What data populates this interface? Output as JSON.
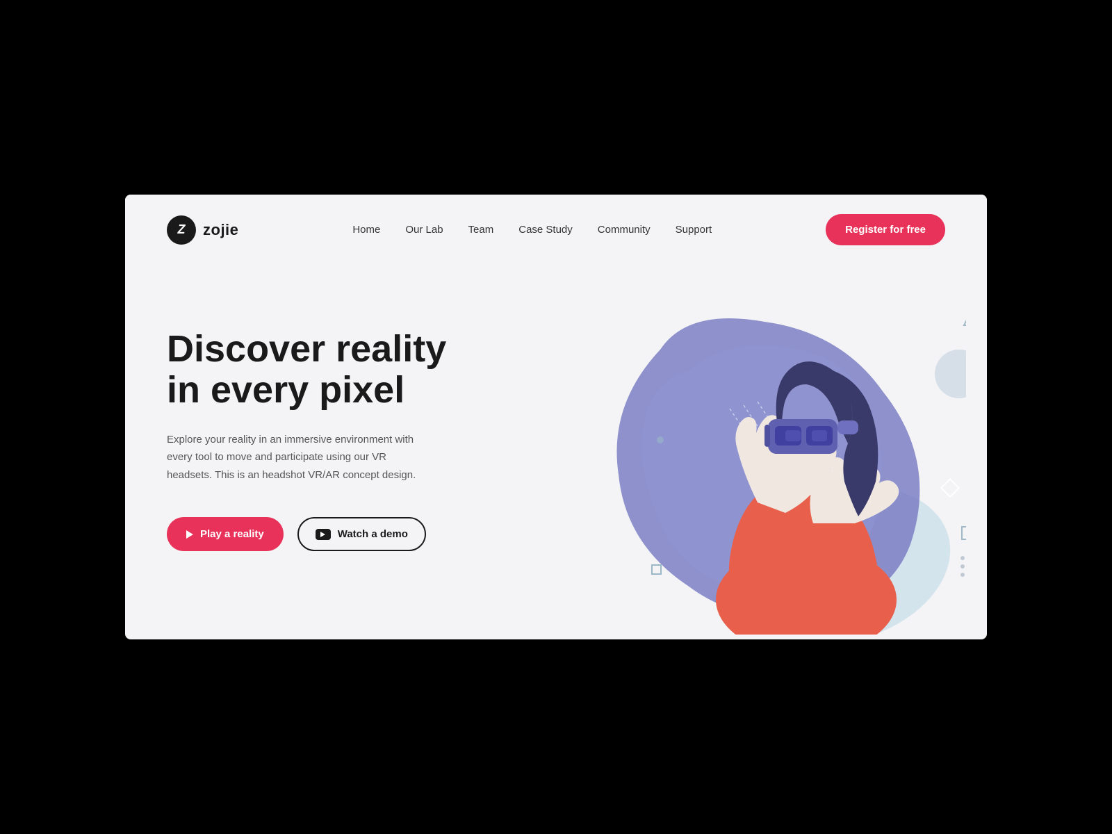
{
  "logo": {
    "letter": "Z",
    "name": "zojie"
  },
  "nav": {
    "links": [
      {
        "label": "Home",
        "id": "home"
      },
      {
        "label": "Our Lab",
        "id": "our-lab"
      },
      {
        "label": "Team",
        "id": "team"
      },
      {
        "label": "Case Study",
        "id": "case-study"
      },
      {
        "label": "Community",
        "id": "community"
      },
      {
        "label": "Support",
        "id": "support"
      }
    ],
    "register_btn": "Register for free"
  },
  "hero": {
    "title_line1": "Discover reality",
    "title_line2": "in every pixel",
    "description": "Explore your reality in an immersive environment with every tool to move and participate using our VR headsets. This is an headshot VR/AR concept design.",
    "btn_play": "Play a reality",
    "btn_demo": "Watch a demo"
  },
  "colors": {
    "brand_red": "#e8325a",
    "blob_purple": "#7b7fc4",
    "blob_light": "#b8bfea",
    "blob_teal": "#c5dde8",
    "accent_coral": "#e8604c"
  }
}
